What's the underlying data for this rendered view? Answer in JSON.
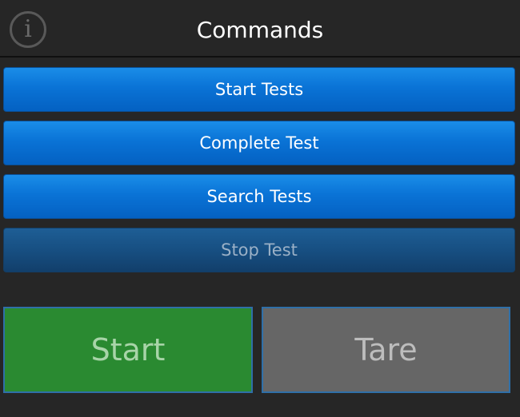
{
  "header": {
    "title": "Commands",
    "info_glyph": "i"
  },
  "commands": {
    "start_tests": "Start Tests",
    "complete_test": "Complete Test",
    "search_tests": "Search Tests",
    "stop_test": "Stop Test"
  },
  "actions": {
    "start": "Start",
    "tare": "Tare"
  },
  "colors": {
    "background": "#262626",
    "button_blue": "#0a73d6",
    "button_disabled": "#174f82",
    "start_green": "#2a8a31",
    "tare_gray": "#666666"
  },
  "icons": {
    "info": "info-icon"
  }
}
